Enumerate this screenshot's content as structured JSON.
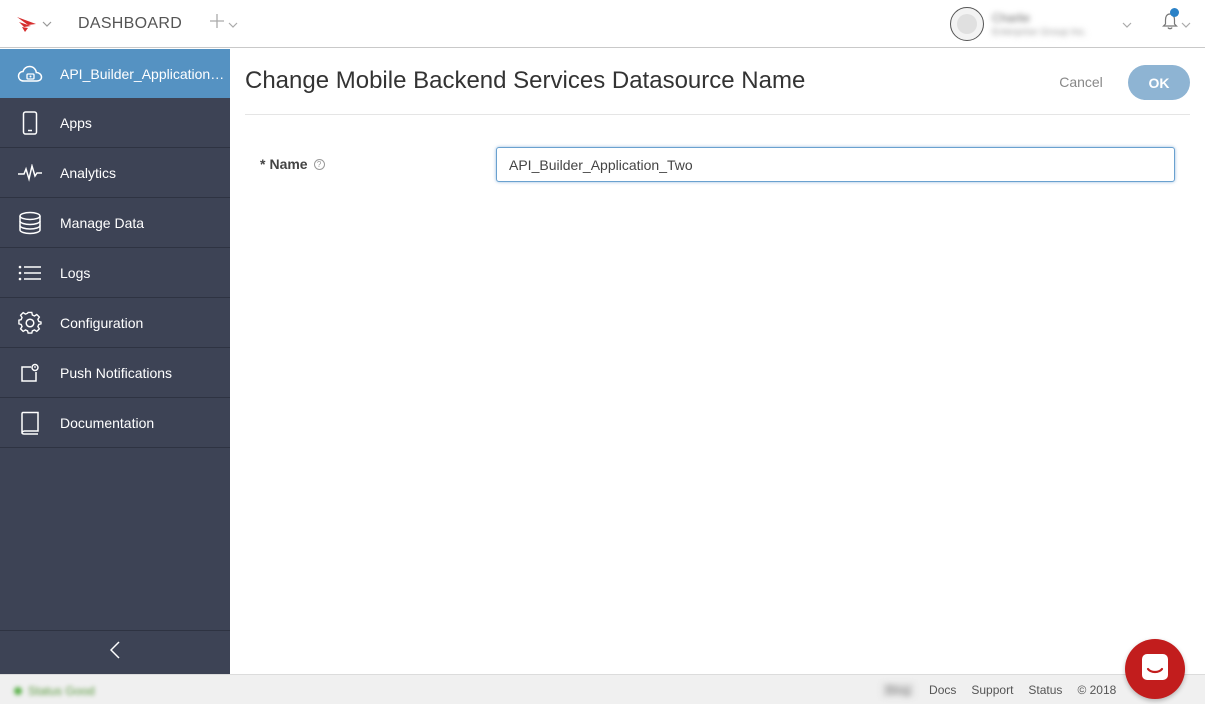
{
  "topbar": {
    "dashboard_label": "DASHBOARD",
    "user_name": "Charlie",
    "user_org": "Enterprise Group Inc."
  },
  "sidebar": {
    "items": [
      {
        "label": "API_Builder_Application_Two",
        "icon": "cloud-icon"
      },
      {
        "label": "Apps",
        "icon": "mobile-icon"
      },
      {
        "label": "Analytics",
        "icon": "pulse-icon"
      },
      {
        "label": "Manage Data",
        "icon": "database-icon"
      },
      {
        "label": "Logs",
        "icon": "list-icon"
      },
      {
        "label": "Configuration",
        "icon": "gear-icon"
      },
      {
        "label": "Push Notifications",
        "icon": "notification-icon"
      },
      {
        "label": "Documentation",
        "icon": "book-icon"
      }
    ]
  },
  "main": {
    "title": "Change Mobile Backend Services Datasource Name",
    "cancel_label": "Cancel",
    "ok_label": "OK",
    "field_label": "Name",
    "required_mark": "*",
    "help_glyph": "?",
    "name_value": "API_Builder_Application_Two"
  },
  "footer": {
    "status_text": "Status Good",
    "blurred_link": "Blog",
    "docs": "Docs",
    "support": "Support",
    "status": "Status",
    "copyright": "© 2018"
  },
  "colors": {
    "sidebar_bg": "#3d4355",
    "sidebar_active": "#5592c2",
    "ok_button": "#8eb4d3",
    "chat_button": "#c21d1d",
    "logo_red": "#d62d2d"
  }
}
